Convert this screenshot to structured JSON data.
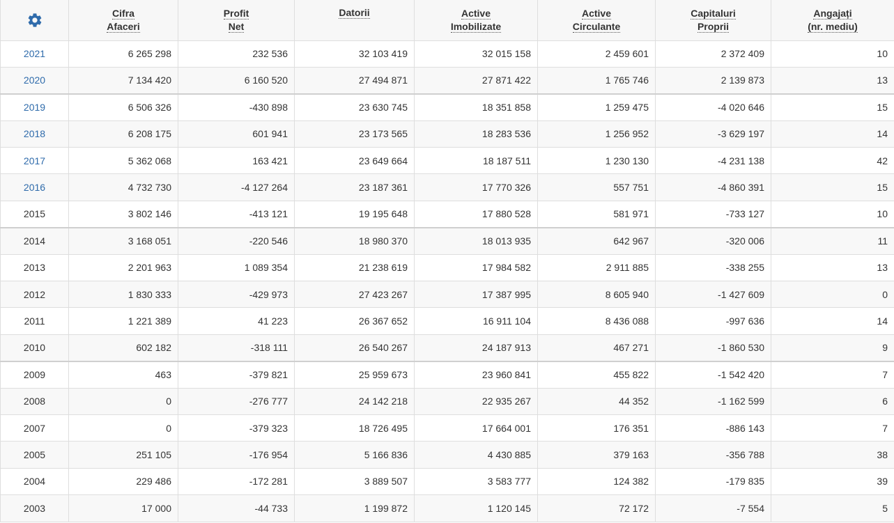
{
  "table": {
    "settings_icon": "gear-icon",
    "accent_color": "#2f6bab",
    "headers": [
      {
        "line1": "Cifra",
        "line2": "Afaceri"
      },
      {
        "line1": "Profit",
        "line2": "Net"
      },
      {
        "line1": "Datorii",
        "line2": ""
      },
      {
        "line1": "Active",
        "line2": "Imobilizate"
      },
      {
        "line1": "Active",
        "line2": "Circulante"
      },
      {
        "line1": "Capitaluri",
        "line2": "Proprii"
      },
      {
        "line1": "Angajați",
        "line2": "(nr. mediu)"
      }
    ],
    "rows": [
      {
        "year": "2021",
        "cells": [
          "6 265 298",
          "232 536",
          "32 103 419",
          "32 015 158",
          "2 459 601",
          "2 372 409",
          "10"
        ]
      },
      {
        "year": "2020",
        "cells": [
          "7 134 420",
          "6 160 520",
          "27 494 871",
          "27 871 422",
          "1 765 746",
          "2 139 873",
          "13"
        ]
      },
      {
        "year": "2019",
        "cells": [
          "6 506 326",
          "-430 898",
          "23 630 745",
          "18 351 858",
          "1 259 475",
          "-4 020 646",
          "15"
        ]
      },
      {
        "year": "2018",
        "cells": [
          "6 208 175",
          "601 941",
          "23 173 565",
          "18 283 536",
          "1 256 952",
          "-3 629 197",
          "14"
        ]
      },
      {
        "year": "2017",
        "cells": [
          "5 362 068",
          "163 421",
          "23 649 664",
          "18 187 511",
          "1 230 130",
          "-4 231 138",
          "42"
        ]
      },
      {
        "year": "2016",
        "cells": [
          "4 732 730",
          "-4 127 264",
          "23 187 361",
          "17 770 326",
          "557 751",
          "-4 860 391",
          "15"
        ]
      },
      {
        "year": "2015",
        "cells": [
          "3 802 146",
          "-413 121",
          "19 195 648",
          "17 880 528",
          "581 971",
          "-733 127",
          "10"
        ]
      },
      {
        "year": "2014",
        "cells": [
          "3 168 051",
          "-220 546",
          "18 980 370",
          "18 013 935",
          "642 967",
          "-320 006",
          "11"
        ]
      },
      {
        "year": "2013",
        "cells": [
          "2 201 963",
          "1 089 354",
          "21 238 619",
          "17 984 582",
          "2 911 885",
          "-338 255",
          "13"
        ]
      },
      {
        "year": "2012",
        "cells": [
          "1 830 333",
          "-429 973",
          "27 423 267",
          "17 387 995",
          "8 605 940",
          "-1 427 609",
          "0"
        ]
      },
      {
        "year": "2011",
        "cells": [
          "1 221 389",
          "41 223",
          "26 367 652",
          "16 911 104",
          "8 436 088",
          "-997 636",
          "14"
        ]
      },
      {
        "year": "2010",
        "cells": [
          "602 182",
          "-318 111",
          "26 540 267",
          "24 187 913",
          "467 271",
          "-1 860 530",
          "9"
        ]
      },
      {
        "year": "2009",
        "cells": [
          "463",
          "-379 821",
          "25 959 673",
          "23 960 841",
          "455 822",
          "-1 542 420",
          "7"
        ]
      },
      {
        "year": "2008",
        "cells": [
          "0",
          "-276 777",
          "24 142 218",
          "22 935 267",
          "44 352",
          "-1 162 599",
          "6"
        ]
      },
      {
        "year": "2007",
        "cells": [
          "0",
          "-379 323",
          "18 726 495",
          "17 664 001",
          "176 351",
          "-886 143",
          "7"
        ]
      },
      {
        "year": "2005",
        "cells": [
          "251 105",
          "-176 954",
          "5 166 836",
          "4 430 885",
          "379 163",
          "-356 788",
          "38"
        ]
      },
      {
        "year": "2004",
        "cells": [
          "229 486",
          "-172 281",
          "3 889 507",
          "3 583 777",
          "124 382",
          "-179 835",
          "39"
        ]
      },
      {
        "year": "2003",
        "cells": [
          "17 000",
          "-44 733",
          "1 199 872",
          "1 120 145",
          "72 172",
          "-7 554",
          "5"
        ]
      }
    ]
  }
}
